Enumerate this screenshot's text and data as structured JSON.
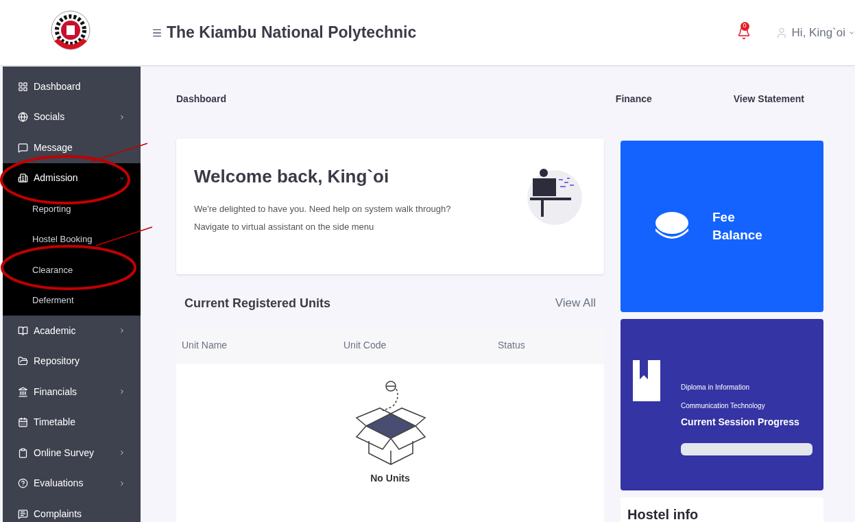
{
  "header": {
    "title": "The Kiambu National Polytechnic",
    "notification_count": "0",
    "user_greeting": "Hi, King`oi"
  },
  "sidebar": {
    "items": [
      {
        "label": "Dashboard",
        "has_submenu": false,
        "expanded": false
      },
      {
        "label": "Socials",
        "has_submenu": true,
        "expanded": false
      },
      {
        "label": "Message",
        "has_submenu": false,
        "expanded": false
      },
      {
        "label": "Admission",
        "has_submenu": true,
        "expanded": true,
        "children": [
          {
            "label": "Reporting"
          },
          {
            "label": "Hostel Booking"
          },
          {
            "label": "Clearance"
          },
          {
            "label": "Deferment"
          }
        ]
      },
      {
        "label": "Academic",
        "has_submenu": true,
        "expanded": false
      },
      {
        "label": "Repository",
        "has_submenu": false,
        "expanded": false
      },
      {
        "label": "Financials",
        "has_submenu": true,
        "expanded": false
      },
      {
        "label": "Timetable",
        "has_submenu": false,
        "expanded": false
      },
      {
        "label": "Online Survey",
        "has_submenu": true,
        "expanded": false
      },
      {
        "label": "Evaluations",
        "has_submenu": true,
        "expanded": false
      },
      {
        "label": "Complaints",
        "has_submenu": false,
        "expanded": false
      }
    ]
  },
  "breadcrumbs": [
    "Dashboard",
    "Finance",
    "View Statement"
  ],
  "welcome": {
    "title": "Welcome back, King`oi",
    "lines": [
      "We're delighted to have you. Need help on system walk through?",
      "Navigate to virtual assistant on the side menu"
    ]
  },
  "units": {
    "title": "Current Registered Units",
    "view_all": "View All",
    "columns": [
      "Unit Name",
      "Unit Code",
      "Status"
    ],
    "empty_text": "No Units"
  },
  "fee_card": {
    "label": "Fee Balance"
  },
  "progress_card": {
    "program": "Diploma in Information Communication Technology",
    "title": "Current Session Progress",
    "level": 0
  },
  "hostel_card": {
    "title": "Hostel info"
  }
}
